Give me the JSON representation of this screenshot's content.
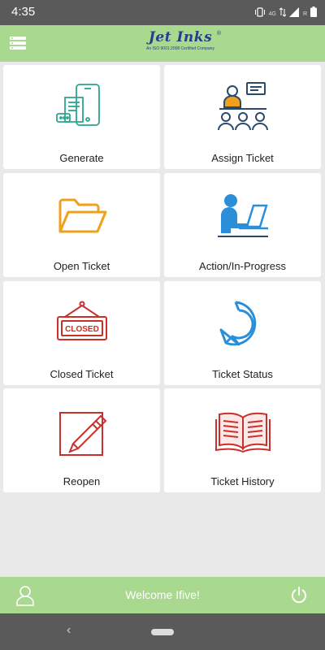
{
  "status_bar": {
    "time": "4:35",
    "network_label": "4G",
    "roaming_label": "R",
    "icons": [
      "vibrate-icon",
      "data-arrows-icon",
      "signal-icon",
      "battery-icon"
    ]
  },
  "header": {
    "brand": "Jet Inks",
    "brand_reg": "®",
    "tagline": "An ISO 9001:2008 Certified Company",
    "menu_icon": "hamburger-menu-icon"
  },
  "tiles": [
    {
      "label": "Generate",
      "icon": "mobile-ticket-icon",
      "color": "#2aa58f"
    },
    {
      "label": "Assign Ticket",
      "icon": "presentation-group-icon",
      "color": "#2b4a6b"
    },
    {
      "label": "Open Ticket",
      "icon": "open-folder-icon",
      "color": "#f0a11b"
    },
    {
      "label": "Action/In-Progress",
      "icon": "person-laptop-icon",
      "color": "#2a8fd8"
    },
    {
      "label": "Closed Ticket",
      "icon": "closed-sign-icon",
      "color": "#c9302c"
    },
    {
      "label": "Ticket Status",
      "icon": "refresh-arrow-icon",
      "color": "#2a8fd8"
    },
    {
      "label": "Reopen",
      "icon": "edit-pencil-icon",
      "color": "#c9302c"
    },
    {
      "label": "Ticket History",
      "icon": "open-book-icon",
      "color": "#c9302c"
    }
  ],
  "closed_sign_text": "CLOSED",
  "bottom_bar": {
    "welcome": "Welcome Ifive!",
    "profile_icon": "user-profile-icon",
    "power_icon": "power-icon"
  },
  "nav_bar": {
    "back_glyph": "‹",
    "back_icon": "back-icon",
    "home_icon": "home-pill-icon"
  },
  "colors": {
    "header_green": "#a8d98f",
    "status_gray": "#5a5a5a",
    "brand_blue": "#233e8b",
    "background": "#e9e9e9"
  }
}
